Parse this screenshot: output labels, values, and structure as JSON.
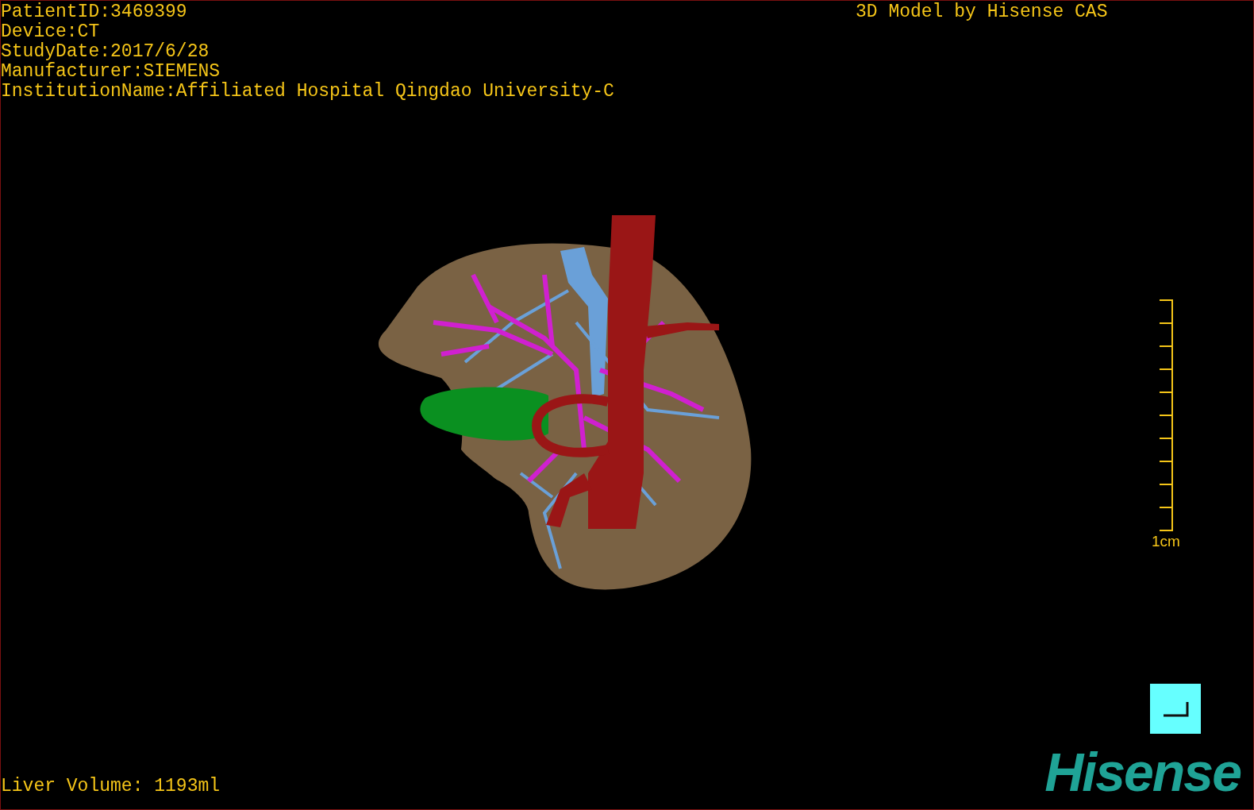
{
  "study_info": [
    "PatientID:3469399",
    "Device:CT",
    "StudyDate:2017/6/28",
    "Manufacturer:SIEMENS",
    "InstitutionName:Affiliated Hospital Qingdao University-C"
  ],
  "model_credit": "3D Model by Hisense CAS",
  "scale_bar": {
    "label": "1cm"
  },
  "liver_volume": "Liver Volume: 1193ml",
  "logo": "Hisense"
}
